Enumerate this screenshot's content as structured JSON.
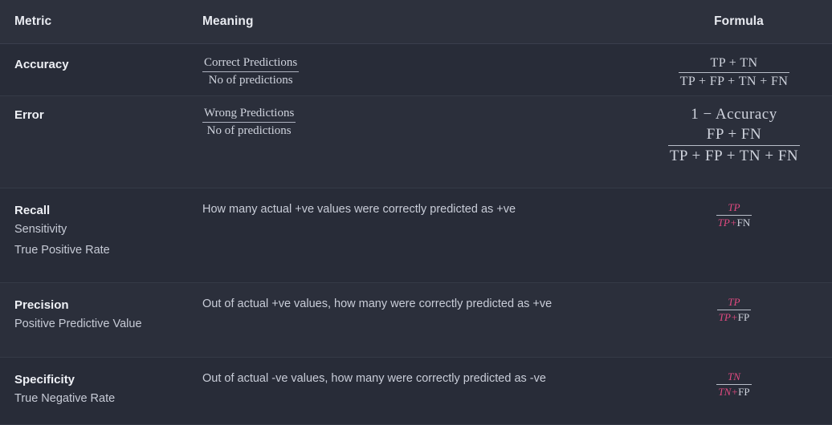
{
  "table": {
    "headers": {
      "metric": "Metric",
      "meaning": "Meaning",
      "formula": "Formula"
    },
    "colors": {
      "page_background": "#282c38",
      "header_background": "#2d313d",
      "row_divider": "#353a47",
      "text_primary": "#eef0f5",
      "text_secondary": "#c9cdd8",
      "math_text": "#cfd3dd",
      "accent_pink": "#e04a80"
    },
    "rows": [
      {
        "id": "accuracy",
        "metric": "Accuracy",
        "metric_aliases": [],
        "meaning_text": "",
        "meaning_fraction": {
          "numerator": "Correct Predictions",
          "denominator": "No of predictions"
        },
        "formula_lines": [],
        "formula_fraction": {
          "numerator": "TP + TN",
          "denominator": "TP + FP + TN + FN"
        }
      },
      {
        "id": "error",
        "metric": "Error",
        "metric_aliases": [],
        "meaning_text": "",
        "meaning_fraction": {
          "numerator": "Wrong Predictions",
          "denominator": "No of predictions"
        },
        "formula_lines": [
          "1 − Accuracy"
        ],
        "formula_fraction": {
          "numerator": "FP + FN",
          "denominator": "TP + FP + TN + FN"
        }
      },
      {
        "id": "recall",
        "metric": "Recall",
        "metric_aliases": [
          "Sensitivity",
          "True Positive Rate"
        ],
        "meaning_text": "How many actual +ve values were correctly predicted as +ve",
        "meaning_fraction": null,
        "formula_lines": [],
        "formula_fraction": {
          "numerator_accent": "TP",
          "denominator_accent": "TP",
          "denominator_operator": "+",
          "denominator_plain": "FN"
        }
      },
      {
        "id": "precision",
        "metric": "Precision",
        "metric_aliases": [
          "Positive Predictive Value"
        ],
        "meaning_text": "Out of actual +ve values, how many were correctly predicted as +ve",
        "meaning_fraction": null,
        "formula_lines": [],
        "formula_fraction": {
          "numerator_accent": "TP",
          "denominator_accent": "TP",
          "denominator_operator": "+",
          "denominator_plain": "FP"
        }
      },
      {
        "id": "specificity",
        "metric": "Specificity",
        "metric_aliases": [
          "True Negative Rate"
        ],
        "meaning_text": "Out of actual -ve values, how many were correctly predicted as -ve",
        "meaning_fraction": null,
        "formula_lines": [],
        "formula_fraction": {
          "numerator_accent": "TN",
          "denominator_accent": "TN",
          "denominator_operator": "+",
          "denominator_plain": "FP"
        }
      }
    ]
  }
}
